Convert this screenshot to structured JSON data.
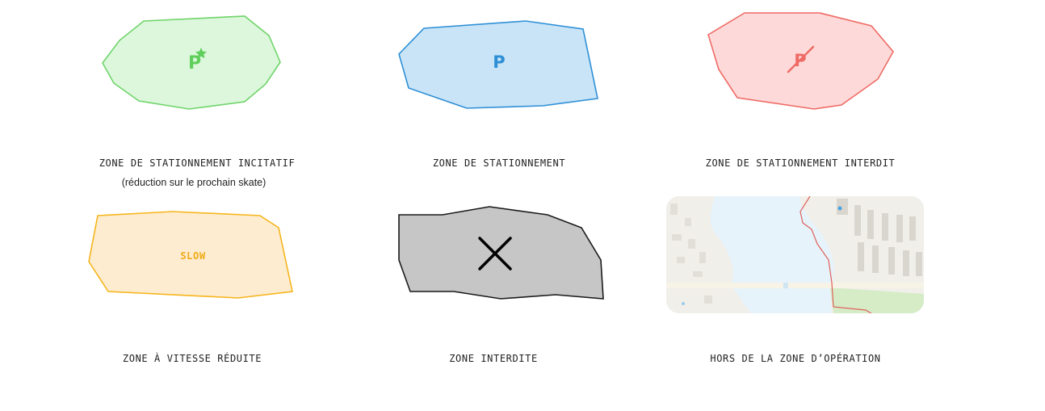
{
  "legend": {
    "incitatif": {
      "label": "ZONE DE STATIONNEMENT INCITATIF",
      "sublabel": "(réduction sur le prochain skate)",
      "icon_text": "P",
      "icon": "parking-star-icon",
      "fill": "#dcf7db",
      "stroke": "#6fd46a",
      "icon_color": "#5fcf5b"
    },
    "stationnement": {
      "label": "ZONE DE STATIONNEMENT",
      "icon_text": "P",
      "icon": "parking-icon",
      "fill": "#c9e4f7",
      "stroke": "#2d8fd6",
      "icon_color": "#2d8fd6"
    },
    "interdit": {
      "label": "ZONE DE STATIONNEMENT INTERDIT",
      "icon_text": "P",
      "icon": "no-parking-icon",
      "fill": "#fddad9",
      "stroke": "#ef6b66",
      "icon_color": "#ef6b66"
    },
    "vitesse": {
      "label": "ZONE À VITESSE RÉDUITE",
      "icon_text": "SLOW",
      "fill": "#fdecd0",
      "stroke": "#f6b51c",
      "icon_color": "#f0ab17"
    },
    "interdite": {
      "label": "ZONE INTERDITE",
      "icon": "cross-icon",
      "fill": "#c6c6c6",
      "stroke": "#1a1a1a",
      "icon_color": "#000000"
    },
    "hors_zone": {
      "label": "HORS DE LA ZONE D’OPÉRATION",
      "icon": "map-thumbnail",
      "boundary_color": "#e0605a",
      "water_color": "#e6f3fb",
      "land_color": "#f1efe9"
    }
  }
}
